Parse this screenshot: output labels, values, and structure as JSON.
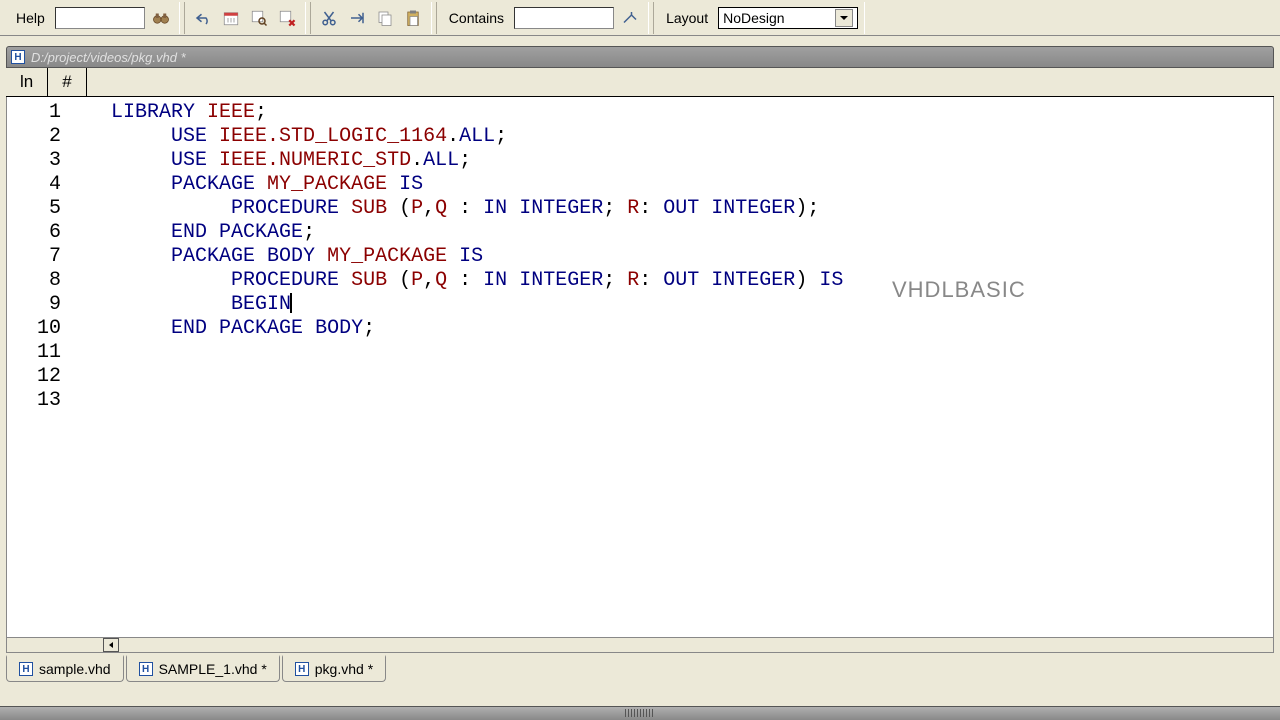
{
  "toolbar": {
    "help_label": "Help",
    "help_input": "",
    "contains_label": "Contains",
    "contains_input": "",
    "layout_label": "Layout",
    "layout_value": "NoDesign"
  },
  "filepath": {
    "icon_letter": "H",
    "path": "D:/project/videos/pkg.vhd *"
  },
  "ln_header": {
    "col1": "ln",
    "col2": "#"
  },
  "code_lines": [
    {
      "n": 1,
      "segments": [
        [
          "kw",
          "LIBRARY"
        ],
        [
          "tk",
          " "
        ],
        [
          "nm",
          "IEEE"
        ],
        [
          "tk",
          ";"
        ]
      ]
    },
    {
      "n": 2,
      "segments": [
        [
          "tk",
          "     "
        ],
        [
          "kw",
          "USE"
        ],
        [
          "tk",
          " "
        ],
        [
          "nm",
          "IEEE.STD_LOGIC_1164"
        ],
        [
          "tk",
          "."
        ],
        [
          "kw",
          "ALL"
        ],
        [
          "tk",
          ";"
        ]
      ]
    },
    {
      "n": 3,
      "segments": [
        [
          "tk",
          "     "
        ],
        [
          "kw",
          "USE"
        ],
        [
          "tk",
          " "
        ],
        [
          "nm",
          "IEEE.NUMERIC_STD"
        ],
        [
          "tk",
          "."
        ],
        [
          "kw",
          "ALL"
        ],
        [
          "tk",
          ";"
        ]
      ]
    },
    {
      "n": 4,
      "segments": [
        [
          "tk",
          "     "
        ],
        [
          "kw",
          "PACKAGE"
        ],
        [
          "tk",
          " "
        ],
        [
          "nm",
          "MY_PACKAGE"
        ],
        [
          "tk",
          " "
        ],
        [
          "kw",
          "IS"
        ]
      ]
    },
    {
      "n": 5,
      "segments": [
        [
          "tk",
          "          "
        ],
        [
          "kw",
          "PROCEDURE"
        ],
        [
          "tk",
          " "
        ],
        [
          "nm",
          "SUB"
        ],
        [
          "tk",
          " ("
        ],
        [
          "nm",
          "P"
        ],
        [
          "tk",
          ","
        ],
        [
          "nm",
          "Q"
        ],
        [
          "tk",
          " : "
        ],
        [
          "kw",
          "IN"
        ],
        [
          "tk",
          " "
        ],
        [
          "kw",
          "INTEGER"
        ],
        [
          "tk",
          "; "
        ],
        [
          "nm",
          "R"
        ],
        [
          "tk",
          ": "
        ],
        [
          "kw",
          "OUT"
        ],
        [
          "tk",
          " "
        ],
        [
          "kw",
          "INTEGER"
        ],
        [
          "tk",
          ");"
        ]
      ]
    },
    {
      "n": 6,
      "segments": [
        [
          "tk",
          "     "
        ],
        [
          "kw",
          "END"
        ],
        [
          "tk",
          " "
        ],
        [
          "kw",
          "PACKAGE"
        ],
        [
          "tk",
          ";"
        ]
      ]
    },
    {
      "n": 7,
      "segments": [
        [
          "tk",
          "     "
        ],
        [
          "kw",
          "PACKAGE"
        ],
        [
          "tk",
          " "
        ],
        [
          "kw",
          "BODY"
        ],
        [
          "tk",
          " "
        ],
        [
          "nm",
          "MY_PACKAGE"
        ],
        [
          "tk",
          " "
        ],
        [
          "kw",
          "IS"
        ]
      ]
    },
    {
      "n": 8,
      "segments": [
        [
          "tk",
          "          "
        ],
        [
          "kw",
          "PROCEDURE"
        ],
        [
          "tk",
          " "
        ],
        [
          "nm",
          "SUB"
        ],
        [
          "tk",
          " ("
        ],
        [
          "nm",
          "P"
        ],
        [
          "tk",
          ","
        ],
        [
          "nm",
          "Q"
        ],
        [
          "tk",
          " : "
        ],
        [
          "kw",
          "IN"
        ],
        [
          "tk",
          " "
        ],
        [
          "kw",
          "INTEGER"
        ],
        [
          "tk",
          "; "
        ],
        [
          "nm",
          "R"
        ],
        [
          "tk",
          ": "
        ],
        [
          "kw",
          "OUT"
        ],
        [
          "tk",
          " "
        ],
        [
          "kw",
          "INTEGER"
        ],
        [
          "tk",
          ") "
        ],
        [
          "kw",
          "IS"
        ]
      ]
    },
    {
      "n": 9,
      "segments": [
        [
          "tk",
          "          "
        ],
        [
          "kw",
          "BEGIN"
        ]
      ],
      "cursor": true
    },
    {
      "n": 10,
      "segments": [
        [
          "tk",
          "     "
        ],
        [
          "kw",
          "END"
        ],
        [
          "tk",
          " "
        ],
        [
          "kw",
          "PACKAGE"
        ],
        [
          "tk",
          " "
        ],
        [
          "kw",
          "BODY"
        ],
        [
          "tk",
          ";"
        ]
      ]
    },
    {
      "n": 11,
      "segments": []
    },
    {
      "n": 12,
      "segments": []
    },
    {
      "n": 13,
      "segments": []
    }
  ],
  "watermark": "VHDLBASIC",
  "file_tabs": [
    {
      "icon": "H",
      "label": "sample.vhd"
    },
    {
      "icon": "H",
      "label": "SAMPLE_1.vhd *"
    },
    {
      "icon": "H",
      "label": "pkg.vhd *"
    }
  ]
}
